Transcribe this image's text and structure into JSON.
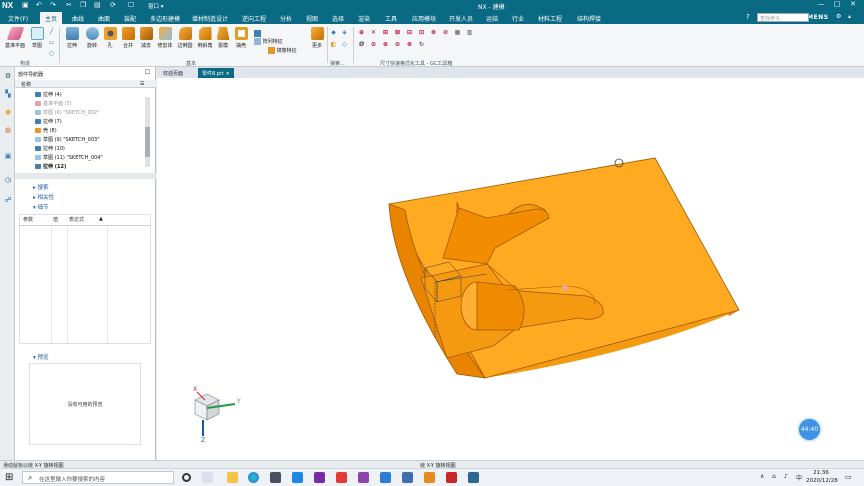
{
  "app": {
    "logo": "NX",
    "title": "NX - 建模",
    "brand": "SIEMENS",
    "window_controls": [
      "—",
      "□",
      "✕"
    ],
    "quick_window": "窗口 ▾"
  },
  "menu": {
    "file_label": "文件(F)",
    "items": [
      "主页",
      "曲线",
      "曲面",
      "装配",
      "多边形建模",
      "增材制造设计",
      "逆向工程",
      "分析",
      "视图",
      "选择",
      "渲染",
      "工具",
      "应用模块",
      "开发人员",
      "运结",
      "行业",
      "材料工程",
      "结构焊接"
    ],
    "active_item": "主页",
    "command_search_placeholder": "查找命令"
  },
  "ribbon": {
    "buttons": [
      "基准平面",
      "草图",
      "拉伸",
      "旋转",
      "孔",
      "合并",
      "减去",
      "修剪体",
      "边倒圆",
      "倒斜角",
      "拔模",
      "抽壳"
    ],
    "small_buttons": [
      "阵列特征",
      "镜像特征",
      "更多"
    ],
    "groups": [
      "构造",
      "基本",
      "弹簧...",
      "尺寸快速格式化工具 - GC工具箱"
    ]
  },
  "tabs": [
    {
      "label": "欢迎页面",
      "active": false
    },
    {
      "label": "零件8.prt",
      "active": true
    }
  ],
  "navigator": {
    "title": "部件导航器",
    "col_name": "名称",
    "rows": [
      {
        "label": "拉伸 (4)",
        "style": "normal"
      },
      {
        "label": "基准平面 (5)",
        "style": "dim"
      },
      {
        "label": "草图 (6) \"SKETCH_002\"",
        "style": "dim"
      },
      {
        "label": "拉伸 (7)",
        "style": "normal"
      },
      {
        "label": "壳 (8)",
        "style": "normal"
      },
      {
        "label": "草图 (9) \"SKETCH_003\"",
        "style": "normal"
      },
      {
        "label": "拉伸 (10)",
        "style": "normal"
      },
      {
        "label": "草图 (11) \"SKETCH_004\"",
        "style": "normal"
      },
      {
        "label": "拉伸 (12)",
        "style": "bold"
      }
    ],
    "sections": [
      "搜索",
      "相关性",
      "细节"
    ],
    "detail_columns": [
      "参数",
      "值",
      "表达式"
    ],
    "preview_title": "预览",
    "preview_empty": "没有可用的预览"
  },
  "status": {
    "left": "滑动鼠标以绕 X-Y 旋转视图",
    "center": "绕 X-Y 旋转视图"
  },
  "viewport": {
    "timer_badge": "44:40",
    "triad_labels": [
      "X",
      "Y",
      "Z"
    ]
  },
  "taskbar": {
    "search_placeholder": "在这里输入你要搜索的内容",
    "time": "21:36",
    "date": "2020/12/28",
    "tray_lang": "中",
    "tray_badge": "英"
  },
  "colors": {
    "accent": "#0a6a84",
    "model_top": "#ffa81c",
    "model_side": "#f07c00",
    "model_edge": "#a25800"
  }
}
